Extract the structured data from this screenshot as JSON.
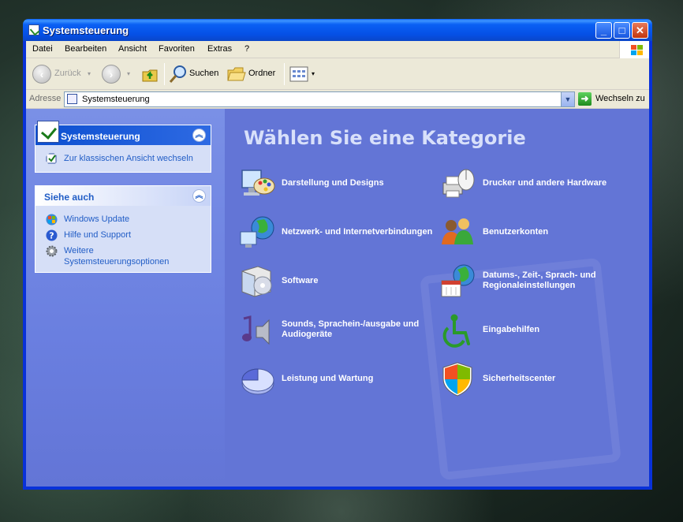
{
  "window": {
    "title": "Systemsteuerung"
  },
  "menubar": {
    "items": [
      "Datei",
      "Bearbeiten",
      "Ansicht",
      "Favoriten",
      "Extras",
      "?"
    ]
  },
  "toolbar": {
    "back_label": "Zurück",
    "search_label": "Suchen",
    "folders_label": "Ordner"
  },
  "address": {
    "label": "Adresse",
    "value": "Systemsteuerung",
    "go_label": "Wechseln zu"
  },
  "sidebar": {
    "panel1": {
      "title": "Systemsteuerung",
      "link": "Zur klassischen Ansicht wechseln"
    },
    "panel2": {
      "title": "Siehe auch",
      "links": [
        "Windows Update",
        "Hilfe und Support",
        "Weitere Systemsteuerungsoptionen"
      ]
    }
  },
  "main": {
    "heading": "Wählen Sie eine Kategorie",
    "categories": [
      "Darstellung und Designs",
      "Drucker und andere Hardware",
      "Netzwerk- und Internetverbindungen",
      "Benutzerkonten",
      "Software",
      "Datums-, Zeit-, Sprach- und Regionaleinstellungen",
      "Sounds, Sprachein-/ausgabe und Audiogeräte",
      "Eingabehilfen",
      "Leistung und Wartung",
      "Sicherheitscenter"
    ]
  }
}
